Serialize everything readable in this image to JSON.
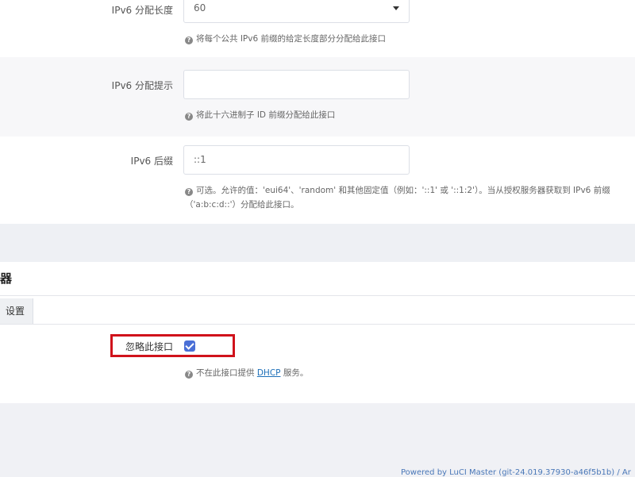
{
  "ipv6_assign_length": {
    "label": "IPv6 分配长度",
    "value": "60",
    "hint": "将每个公共 IPv6 前缀的给定长度部分分配给此接口"
  },
  "ipv6_assign_hint": {
    "label": "IPv6 分配提示",
    "value": "",
    "hint": "将此十六进制子 ID 前缀分配给此接口"
  },
  "ipv6_suffix": {
    "label": "IPv6 后缀",
    "value": "::1",
    "hint_line1": "可选。允许的值：'eui64'、'random' 和其他固定值（例如：'::1' 或 '::1:2'）。当从授权服务器获取到 IPv6 前缀",
    "hint_line2": "（'a:b:c:d::'）分配给此接口。"
  },
  "dhcp_section": {
    "title": "器",
    "tab_label": "设置",
    "ignore_label": "忽略此接口",
    "ignore_checked": true,
    "hint_before": "不在此接口提供",
    "hint_link": "DHCP",
    "hint_after": "服务。"
  },
  "footer": {
    "text": "Powered by LuCI Master (git-24.019.37930-a46f5b1b) / Ar"
  },
  "colors": {
    "accent": "#4a6fd6",
    "highlight": "#d0121b",
    "link": "#1c6fb8"
  }
}
